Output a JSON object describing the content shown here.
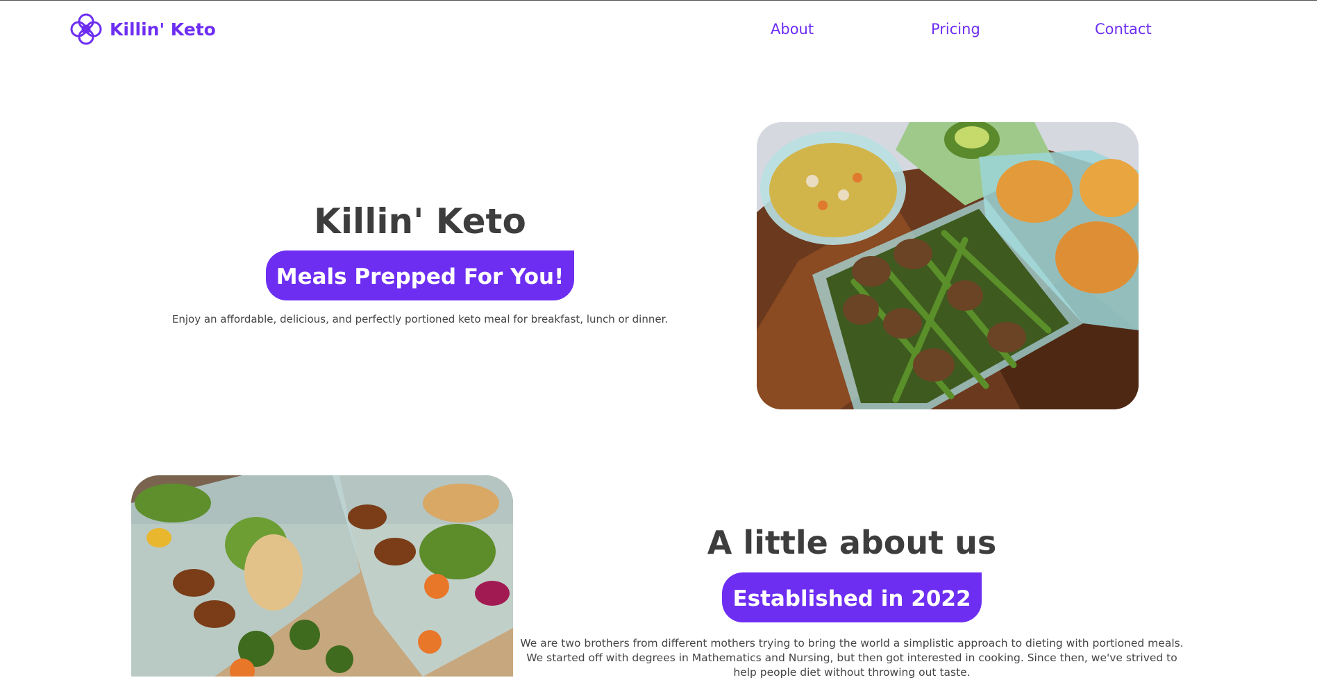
{
  "brand": {
    "name": "Killin' Keto",
    "color": "#6d2ef2",
    "logo_icon": "four-petal-flower-icon"
  },
  "nav": {
    "about": "About",
    "pricing": "Pricing",
    "contact": "Contact"
  },
  "hero": {
    "title": "Killin' Keto",
    "badge": "Meals Prepped For You!",
    "description": "Enjoy an affordable, delicious, and perfectly portioned keto meal for breakfast, lunch or dinner.",
    "image": "keto meal prep containers with chicken, green beans and soup"
  },
  "about": {
    "title": "A little about us",
    "badge": "Established in 2022",
    "text": "We are two brothers from different mothers trying to bring the world a simplistic approach to dieting with portioned meals. We started off with degrees in Mathematics and Nursing, but then got interested in cooking. Since then, we've strived to help people diet without throwing out taste.",
    "image": "glass meal prep containers with chicken, pecans, broccoli and carrots"
  }
}
